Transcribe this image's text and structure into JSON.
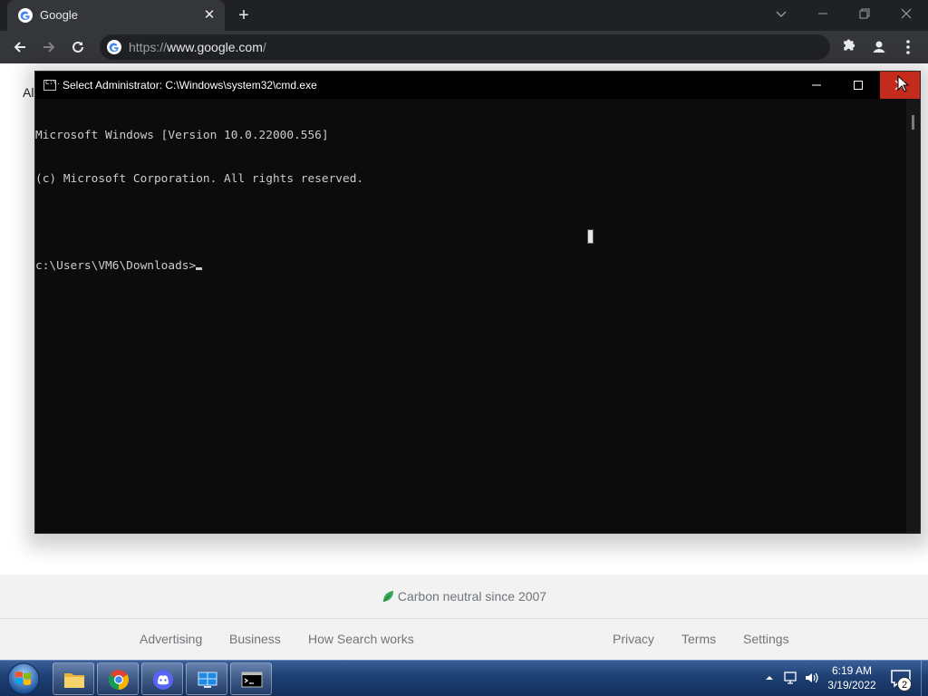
{
  "browser": {
    "tab": {
      "title": "Google",
      "close_glyph": "✕"
    },
    "new_tab_glyph": "+",
    "address": {
      "scheme": "https://",
      "host": "www.google.com",
      "path": "/"
    },
    "page": {
      "partial_text": "Al",
      "carbon_text": "Carbon neutral since 2007",
      "footer_links_left": [
        "Advertising",
        "Business",
        "How Search works"
      ],
      "footer_links_right": [
        "Privacy",
        "Terms",
        "Settings"
      ]
    }
  },
  "cmd": {
    "title": "Select Administrator: C:\\Windows\\system32\\cmd.exe",
    "icon_text": "C:\\.",
    "lines": [
      "Microsoft Windows [Version 10.0.22000.556]",
      "(c) Microsoft Corporation. All rights reserved.",
      "",
      "c:\\Users\\VM6\\Downloads>"
    ]
  },
  "taskbar": {
    "apps": [
      "file-explorer",
      "chrome",
      "discord",
      "remote-desktop",
      "command-prompt"
    ],
    "clock": {
      "time": "6:19 AM",
      "date": "3/19/2022"
    },
    "notification_count": "2"
  },
  "colors": {
    "chrome_dark": "#202124",
    "chrome_toolbar": "#35363a",
    "cmd_bg": "#0c0c0c",
    "close_red": "#c42b1c",
    "taskbar_blue": "#1d3f73"
  }
}
